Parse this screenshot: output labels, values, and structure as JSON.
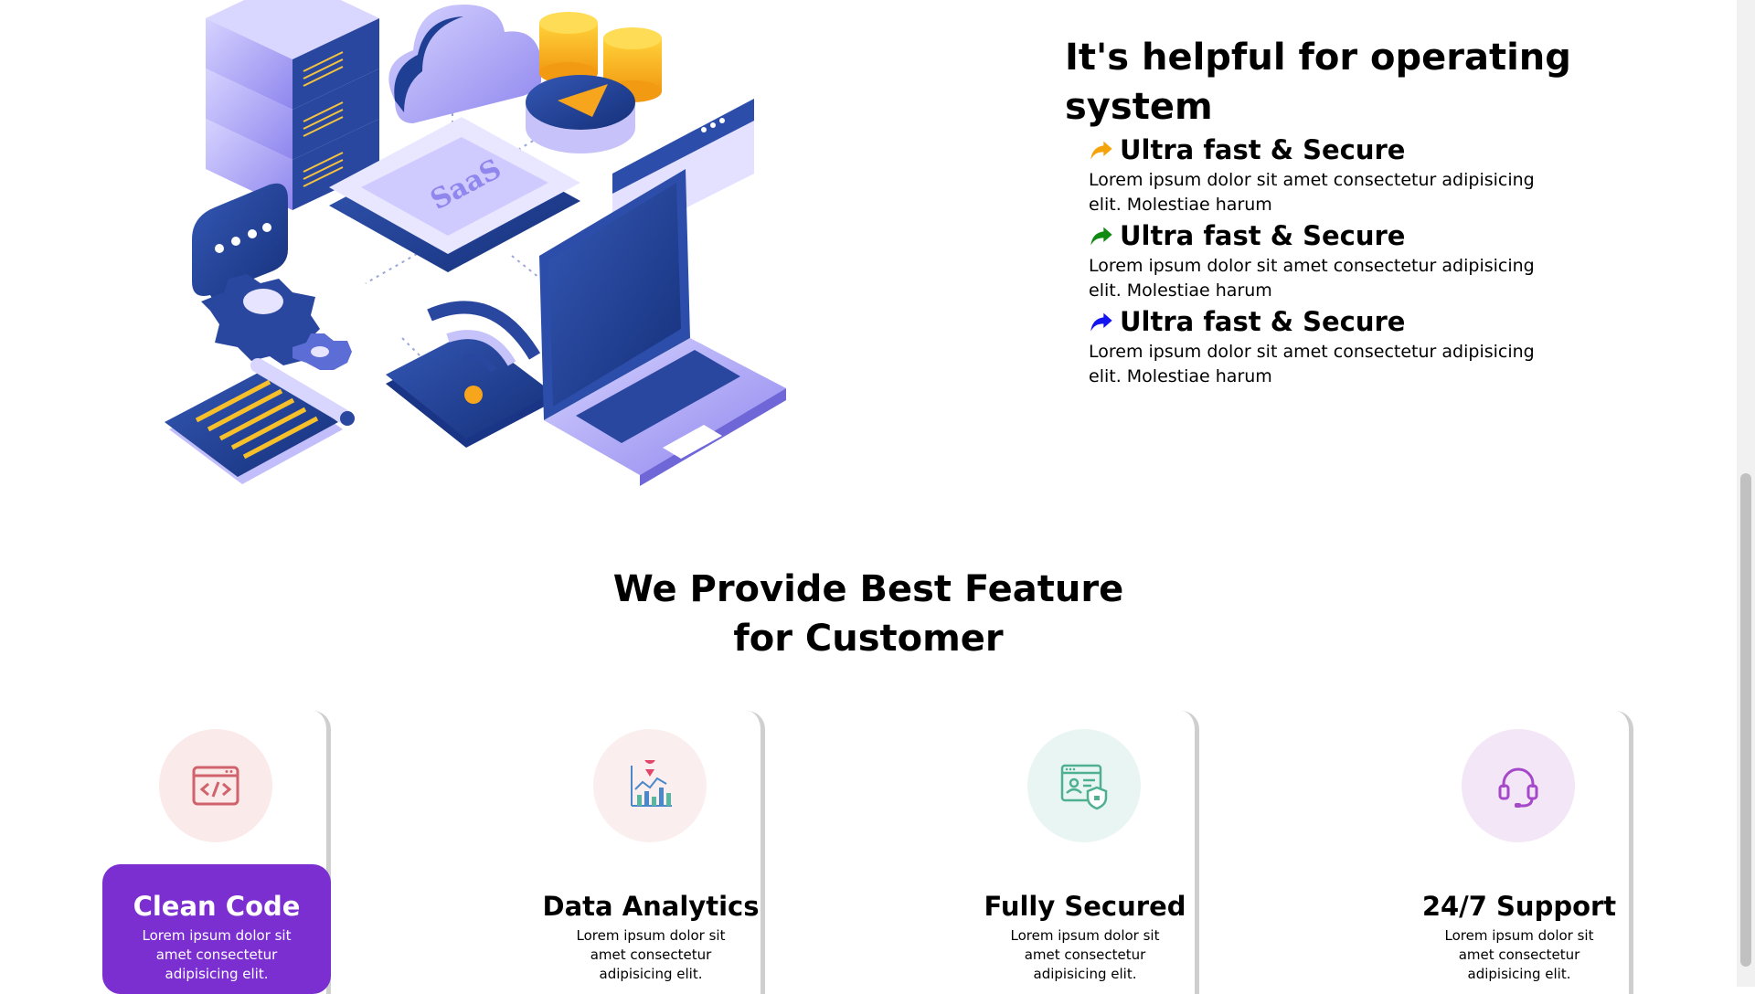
{
  "hero": {
    "heading": "It's helpful for operating system",
    "illustration_label": "SaaS",
    "features": [
      {
        "icon": "share-arrow-icon",
        "color": "#f5a30a",
        "title": "Ultra fast & Secure",
        "text": "Lorem ipsum dolor sit amet consectetur adipisicing elit. Molestiae harum"
      },
      {
        "icon": "share-arrow-icon",
        "color": "#118a11",
        "title": "Ultra fast & Secure",
        "text": "Lorem ipsum dolor sit amet consectetur adipisicing elit. Molestiae harum"
      },
      {
        "icon": "share-arrow-icon",
        "color": "#1414f0",
        "title": "Ultra fast & Secure",
        "text": "Lorem ipsum dolor sit amet consectetur adipisicing elit. Molestiae harum"
      }
    ]
  },
  "features_section": {
    "title_line1": "We Provide Best Feature",
    "title_line2": "for Customer",
    "cards": [
      {
        "icon": "code-window-icon",
        "circle_color": "#fbeaea",
        "title": "Clean Code",
        "text": "Lorem ipsum dolor sit amet consectetur adipisicing elit.",
        "active": true
      },
      {
        "icon": "analytics-chart-icon",
        "circle_color": "#fbeeee",
        "title": "Data Analytics",
        "text": "Lorem ipsum dolor sit amet consectetur adipisicing elit.",
        "active": false
      },
      {
        "icon": "secure-profile-icon",
        "circle_color": "#e8f5f3",
        "title": "Fully Secured",
        "text": "Lorem ipsum dolor sit amet consectetur adipisicing elit.",
        "active": false
      },
      {
        "icon": "headset-icon",
        "circle_color": "#f3e6f6",
        "title": "24/7 Support",
        "text": "Lorem ipsum dolor sit amet consectetur adipisicing elit.",
        "active": false
      }
    ]
  },
  "colors": {
    "accent": "#7b2fd1",
    "illustration_dark": "#1d3a8a",
    "illustration_light": "#a9a3f5",
    "coin": "#f7b21c"
  }
}
